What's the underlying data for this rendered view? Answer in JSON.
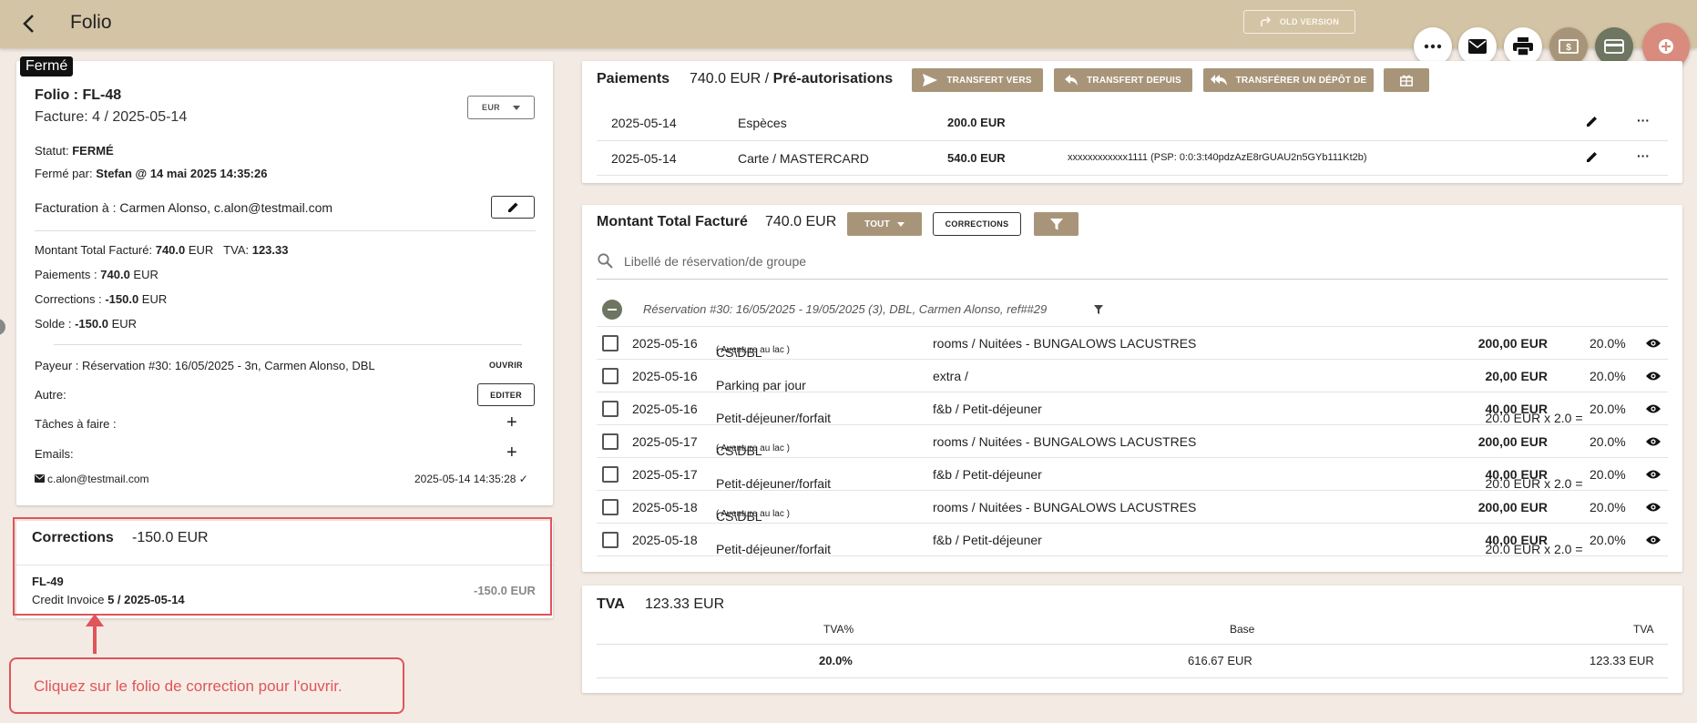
{
  "header": {
    "title": "Folio",
    "old_version_label": "OLD VERSION"
  },
  "folio": {
    "status_badge": "Fermé",
    "folio_label": "Folio : ",
    "folio_id": "FL-48",
    "facture": "Facture: 4 / 2025-05-14",
    "currency": "EUR",
    "statut_label": "Statut: ",
    "statut_value": "FERMÉ",
    "ferme_par_label": "Fermé par: ",
    "ferme_par_value": "Stefan @ 14 mai 2025 14:35:26",
    "facturation": "Facturation à : Carmen Alonso, c.alon@testmail.com",
    "montant_label": "Montant Total Facturé: ",
    "montant_value": "740.0",
    "montant_currency": " EUR",
    "tva_label": "TVA: ",
    "tva_value": "123.33",
    "paiements_label": "Paiements : ",
    "paiements_value": "740.0",
    "paiements_currency": " EUR",
    "corrections_label": "Corrections : ",
    "corrections_value": "-150.0",
    "corrections_currency": " EUR",
    "solde_label": "Solde : ",
    "solde_value": "-150.0",
    "solde_currency": " EUR",
    "payeur": "Payeur : Réservation #30: 16/05/2025 - 3n, Carmen Alonso, DBL",
    "ouvrir_label": "OUVRIR",
    "autre_label": "Autre:",
    "editer_label": "EDITER",
    "taches_label": "Tâches à faire :",
    "emails_label": "Emails:",
    "email": "c.alon@testmail.com",
    "email_date": "2025-05-14 14:35:28"
  },
  "corrections_card": {
    "title": "Corrections",
    "total": "-150.0 EUR",
    "item_id": "FL-49",
    "item_prefix": "Credit Invoice ",
    "item_ref": "5 / 2025-05-14",
    "item_amount": "-150.0 EUR"
  },
  "hint": "Cliquez sur le folio de correction pour l'ouvrir.",
  "paiements": {
    "title": "Paiements",
    "amount": "740.0 EUR / ",
    "preauth": "Pré-autorisations",
    "btn_transfert_vers": "TRANSFERT VERS",
    "btn_transfert_depuis": "TRANSFERT DEPUIS",
    "btn_transferer_depot": "TRANSFÉRER UN DÉPÔT DE",
    "rows": [
      {
        "date": "2025-05-14",
        "method": "Espèces",
        "amount": "200.0 EUR",
        "ref": ""
      },
      {
        "date": "2025-05-14",
        "method": "Carte / MASTERCARD",
        "amount": "540.0 EUR",
        "ref": "xxxxxxxxxxxx1111 (PSP: 0:0:3:t40pdzAzE8rGUAU2n5GYb111Kt2b)"
      }
    ]
  },
  "montant": {
    "title": "Montant Total Facturé",
    "amount": "740.0 EUR",
    "btn_tout": "TOUT",
    "btn_corrections": "CORRECTIONS",
    "search_placeholder": "Libellé de réservation/de groupe",
    "group_label": "Réservation #30: 16/05/2025 - 19/05/2025 (3), DBL, Carmen Alonso, ref##29",
    "rows": [
      {
        "date": "2025-05-16",
        "item": "CS\\DBL",
        "sub": "( Aventure au lac )",
        "cat": "rooms / Nuitées - BUNGALOWS LACUSTRES",
        "calc": "",
        "amount": "200,00 EUR",
        "tax": "20.0%"
      },
      {
        "date": "2025-05-16",
        "item": "Parking par jour",
        "sub": "",
        "cat": "extra /",
        "calc": "",
        "amount": "20,00 EUR",
        "tax": "20.0%"
      },
      {
        "date": "2025-05-16",
        "item": "Petit-déjeuner/forfait",
        "sub": "",
        "cat": "f&b / Petit-déjeuner",
        "calc": "20.0 EUR x 2.0 = ",
        "amount": "40,00 EUR",
        "tax": "20.0%"
      },
      {
        "date": "2025-05-17",
        "item": "CS\\DBL",
        "sub": "( Aventure au lac )",
        "cat": "rooms / Nuitées - BUNGALOWS LACUSTRES",
        "calc": "",
        "amount": "200,00 EUR",
        "tax": "20.0%"
      },
      {
        "date": "2025-05-17",
        "item": "Petit-déjeuner/forfait",
        "sub": "",
        "cat": "f&b / Petit-déjeuner",
        "calc": "20.0 EUR x 2.0 = ",
        "amount": "40,00 EUR",
        "tax": "20.0%"
      },
      {
        "date": "2025-05-18",
        "item": "CS\\DBL",
        "sub": "( Aventure au lac )",
        "cat": "rooms / Nuitées - BUNGALOWS LACUSTRES",
        "calc": "",
        "amount": "200,00 EUR",
        "tax": "20.0%"
      },
      {
        "date": "2025-05-18",
        "item": "Petit-déjeuner/forfait",
        "sub": "",
        "cat": "f&b / Petit-déjeuner",
        "calc": "20.0 EUR x 2.0 = ",
        "amount": "40,00 EUR",
        "tax": "20.0%"
      }
    ]
  },
  "tva": {
    "title": "TVA",
    "amount": "123.33 EUR",
    "col_rate": "TVA%",
    "col_base": "Base",
    "col_tva": "TVA",
    "rate": "20.0%",
    "base": "616.67 EUR",
    "value": "123.33 EUR"
  },
  "colors": {
    "header_bg": "#d4c4a6",
    "tan_button": "#a89579",
    "highlight_red": "#e0545a",
    "fab_primary": "#d98c7e",
    "fab_green": "#6e7560"
  }
}
